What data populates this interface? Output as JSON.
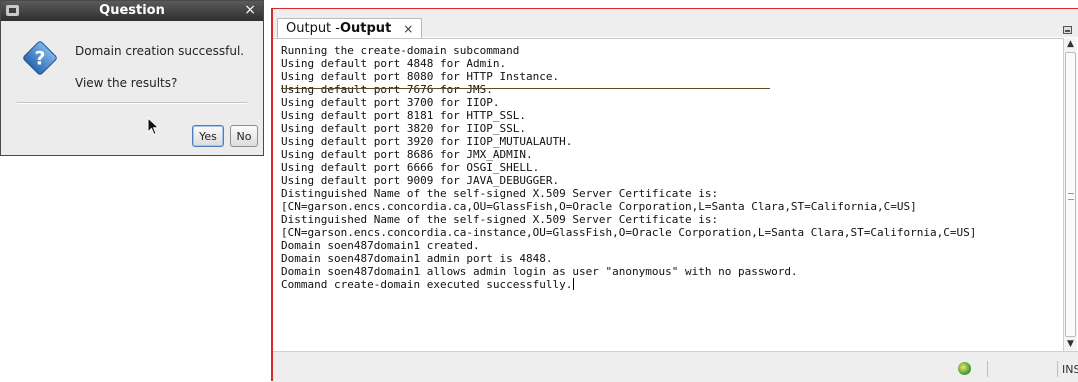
{
  "dialog": {
    "title": "Question",
    "close_glyph": "×",
    "message_line1": "Domain creation successful.",
    "message_line2": "View the results?",
    "yes_label": "Yes",
    "no_label": "No",
    "icon": "question-icon"
  },
  "output": {
    "tab_prefix": "Output - ",
    "tab_name": "Output",
    "tab_close_glyph": "×",
    "lines": [
      "Running the create-domain subcommand",
      "Using default port 4848 for Admin.",
      "Using default port 8080 for HTTP Instance.",
      "Using default port 7676 for JMS.",
      "Using default port 3700 for IIOP.",
      "Using default port 8181 for HTTP_SSL.",
      "Using default port 3820 for IIOP_SSL.",
      "Using default port 3920 for IIOP_MUTUALAUTH.",
      "Using default port 8686 for JMX_ADMIN.",
      "Using default port 6666 for OSGI_SHELL.",
      "Using default port 9009 for JAVA_DEBUGGER.",
      "Distinguished Name of the self-signed X.509 Server Certificate is:",
      "[CN=garson.encs.concordia.ca,OU=GlassFish,O=Oracle Corporation,L=Santa Clara,ST=California,C=US]",
      "Distinguished Name of the self-signed X.509 Server Certificate is:",
      "[CN=garson.encs.concordia.ca-instance,OU=GlassFish,O=Oracle Corporation,L=Santa Clara,ST=California,C=US]",
      "Domain soen487domain1 created.",
      "Domain soen487domain1 admin port is 4848.",
      "Domain soen487domain1 allows admin login as user \"anonymous\" with no password.",
      "Command create-domain executed successfully."
    ]
  },
  "statusbar": {
    "insert_mode": "INS"
  }
}
